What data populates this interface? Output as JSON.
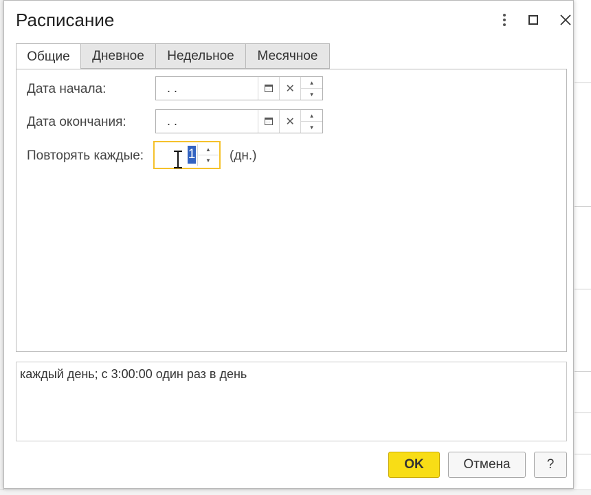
{
  "window": {
    "title": "Расписание"
  },
  "tabs": [
    {
      "label": "Общие",
      "active": true
    },
    {
      "label": "Дневное",
      "active": false
    },
    {
      "label": "Недельное",
      "active": false
    },
    {
      "label": "Месячное",
      "active": false
    }
  ],
  "general": {
    "start_date_label": "Дата начала:",
    "start_date_value": " .  .",
    "end_date_label": "Дата окончания:",
    "end_date_value": " .  .",
    "repeat_label": "Повторять каждые:",
    "repeat_value": "1",
    "repeat_unit": "(дн.)"
  },
  "summary": {
    "text": "каждый день; с 3:00:00 один раз в день"
  },
  "buttons": {
    "ok": "OK",
    "cancel": "Отмена",
    "help": "?"
  },
  "colors": {
    "accent_yellow": "#f8dd16",
    "focus_border": "#f5c12b",
    "selection": "#3363c1"
  }
}
